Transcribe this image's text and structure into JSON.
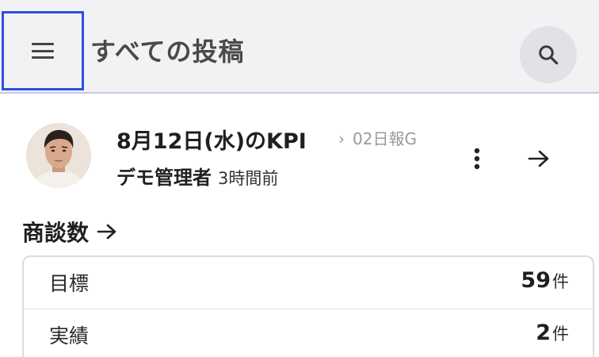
{
  "header": {
    "title": "すべての投稿",
    "menu_icon": "hamburger-menu-icon",
    "search_icon": "search-icon"
  },
  "post": {
    "title": "8月12日(水)のKPI",
    "group_separator": "›",
    "group": "02日報G",
    "author": "デモ管理者",
    "time_ago": "3時間前"
  },
  "section": {
    "heading": "商談数"
  },
  "kpi": [
    {
      "label": "目標",
      "value": "59",
      "unit": "件"
    },
    {
      "label": "実績",
      "value": "2",
      "unit": "件"
    }
  ],
  "colors": {
    "header_bg": "#f2f2f5",
    "focus_outline": "#2d4fe0",
    "header_divider": "#c9c6e6"
  }
}
